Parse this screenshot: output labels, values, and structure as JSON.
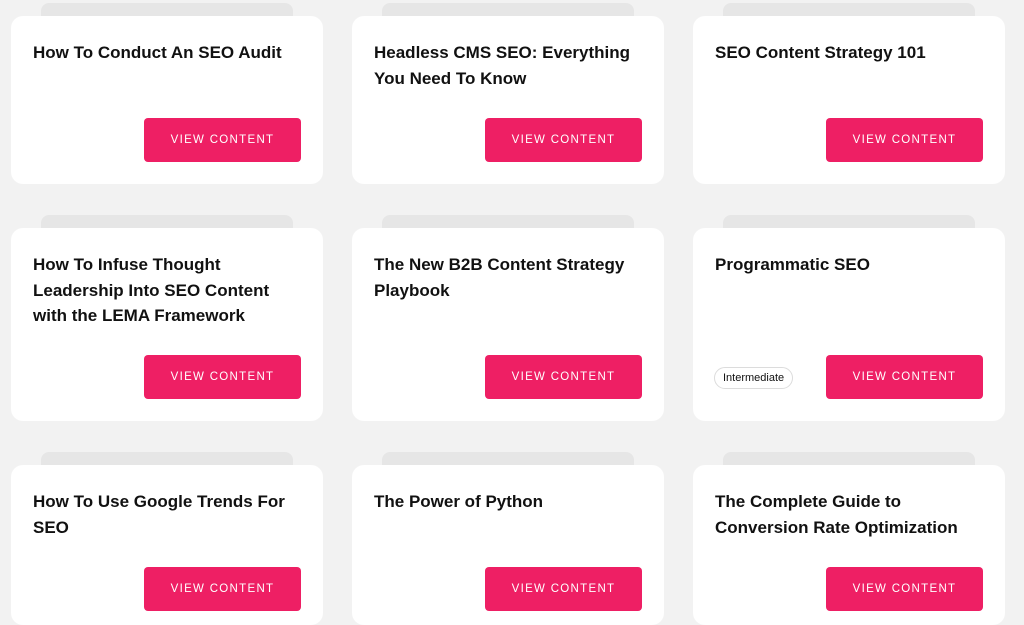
{
  "cards": [
    {
      "title": "How To Conduct An SEO Audit",
      "button_label": "VIEW CONTENT"
    },
    {
      "title": "Headless CMS SEO: Everything You Need To Know",
      "button_label": "VIEW CONTENT"
    },
    {
      "title": "SEO Content Strategy 101",
      "button_label": "VIEW CONTENT"
    },
    {
      "title": "How To Infuse Thought Leadership Into SEO Content with the LEMA Framework",
      "button_label": "VIEW CONTENT"
    },
    {
      "title": "The New B2B Content Strategy Playbook",
      "button_label": "VIEW CONTENT"
    },
    {
      "title": "Programmatic SEO",
      "button_label": "VIEW CONTENT",
      "badge": "Intermediate"
    },
    {
      "title": "How To Use Google Trends For SEO",
      "button_label": "VIEW CONTENT"
    },
    {
      "title": "The Power of Python",
      "button_label": "VIEW CONTENT"
    },
    {
      "title": "The Complete Guide to Conversion Rate Optimization",
      "button_label": "VIEW CONTENT"
    }
  ],
  "colors": {
    "page_background": "#f2f2f2",
    "card_background": "#ffffff",
    "button_background": "#ee1f64",
    "button_text": "#ffffff",
    "title_text": "#111111"
  }
}
